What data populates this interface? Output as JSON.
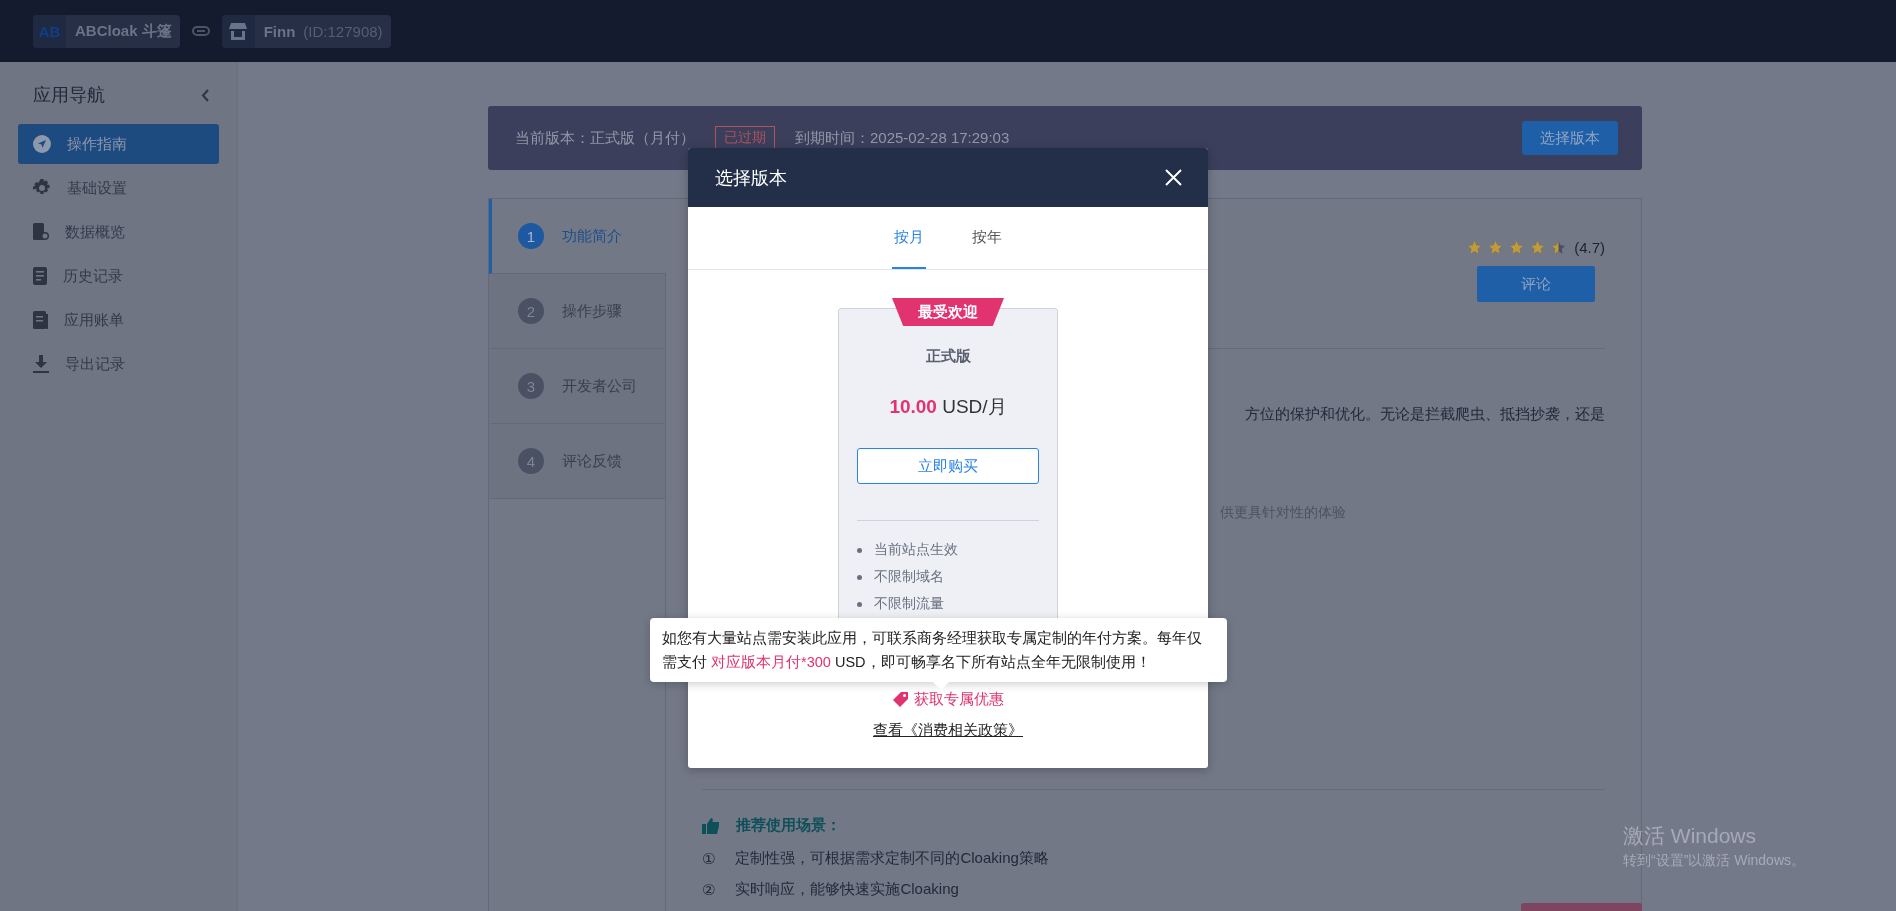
{
  "topbar": {
    "app_badge": "AB",
    "app_name": "ABCloak 斗篷",
    "store_name": "Finn",
    "store_id": "(ID:127908)"
  },
  "sidebar": {
    "title": "应用导航",
    "items": [
      {
        "label": "操作指南",
        "selected": true
      },
      {
        "label": "基础设置",
        "selected": false
      },
      {
        "label": "数据概览",
        "selected": false
      },
      {
        "label": "历史记录",
        "selected": false
      },
      {
        "label": "应用账单",
        "selected": false
      },
      {
        "label": "导出记录",
        "selected": false
      }
    ]
  },
  "version_bar": {
    "current": "当前版本：正式版（月付）",
    "status": "已过期",
    "expiry": "到期时间：2025-02-28 17:29:03",
    "button": "选择版本"
  },
  "steps": [
    {
      "number": "1",
      "label": "功能简介",
      "selected": true
    },
    {
      "number": "2",
      "label": "操作步骤",
      "selected": false
    },
    {
      "number": "3",
      "label": "开发者公司",
      "selected": false
    },
    {
      "number": "4",
      "label": "评论反馈",
      "selected": false
    }
  ],
  "rating": {
    "stars": 4.5,
    "score": "(4.7)",
    "button": "评论"
  },
  "intro_lines": [
    "方位的保护和优化。无论是拦截爬虫、抵挡抄袭，还是",
    "供更具针对性的体验"
  ],
  "scenarios": {
    "title": "推荐使用场景：",
    "items": [
      {
        "marker": "①",
        "text": "定制性强，可根据需求定制不同的Cloaking策略"
      },
      {
        "marker": "②",
        "text": "实时响应，能够快速实施Cloaking"
      }
    ]
  },
  "modal": {
    "title": "选择版本",
    "tabs": [
      {
        "label": "按月",
        "selected": true
      },
      {
        "label": "按年",
        "selected": false
      }
    ],
    "plan": {
      "ribbon": "最受欢迎",
      "name": "正式版",
      "price": "10.00",
      "unit": "USD/月",
      "buy_button": "立即购买",
      "features": [
        "当前站点生效",
        "不限制域名",
        "不限制流量"
      ]
    },
    "tooltip": {
      "before": "如您有大量站点需安装此应用，可联系商务经理获取专属定制的年付方案。每年仅需支付 ",
      "highlight": "对应版本月付*300",
      "after": " USD，即可畅享名下所有站点全年无限制使用！"
    },
    "offer_link": "获取专属优惠",
    "policy_link": "查看《消费相关政策》"
  },
  "os_notice": {
    "title": "激活 Windows",
    "subtitle": "转到“设置”以激活 Windows。"
  }
}
